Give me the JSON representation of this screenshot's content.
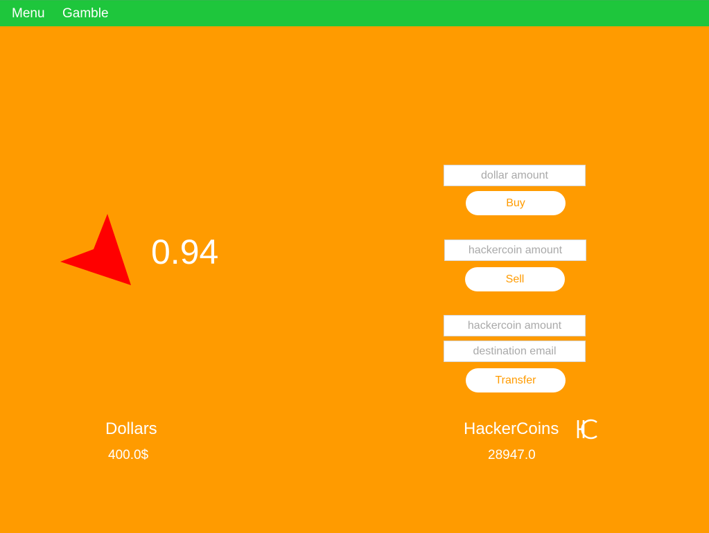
{
  "nav": {
    "menu_label": "Menu",
    "gamble_label": "Gamble"
  },
  "ticker": {
    "price": "0.94",
    "trend_icon": "red-arrow-icon",
    "trend_color": "#ff0000"
  },
  "buy": {
    "placeholder": "dollar amount",
    "button_label": "Buy"
  },
  "sell": {
    "placeholder": "hackercoin amount",
    "button_label": "Sell"
  },
  "transfer": {
    "amount_placeholder": "hackercoin amount",
    "email_placeholder": "destination email",
    "button_label": "Transfer"
  },
  "balances": {
    "dollars_label": "Dollars",
    "dollars_value": "400.0$",
    "coins_label": "HackerCoins",
    "coins_value": "28947.0",
    "coin_icon": "hackercoin-logo-icon"
  },
  "colors": {
    "background": "#ff9b00",
    "nav_bar": "#1ec63c",
    "accent_text": "#ff9b00",
    "arrow": "#ff0000"
  }
}
